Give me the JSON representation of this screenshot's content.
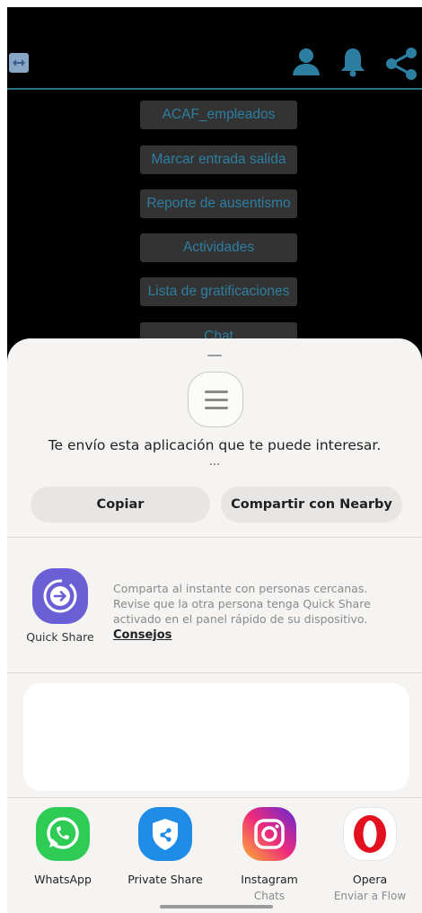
{
  "background_app": {
    "menu": [
      "ACAF_empleados",
      "Marcar entrada salida",
      "Reporte de ausentismo",
      "Actividades",
      "Lista de gratificaciones",
      "Chat"
    ],
    "header_icons": [
      "user-icon",
      "bell-icon",
      "share-icon"
    ],
    "accent_color": "#2d7fa2"
  },
  "share_sheet": {
    "message": "Te envío esta aplicación que te puede interesar.",
    "ellipsis": "...",
    "copy_label": "Copiar",
    "nearby_label": "Compartir con Nearby",
    "quick_share": {
      "label": "Quick Share",
      "description": "Comparta al instante con personas cercanas. Revise que la otra persona tenga Quick Share activado en el panel rápido de su dispositivo.",
      "link": "Consejos"
    },
    "apps": [
      {
        "name": "WhatsApp",
        "sub": "",
        "icon": "whatsapp-icon"
      },
      {
        "name": "Private Share",
        "sub": "",
        "icon": "private-share-icon"
      },
      {
        "name": "Instagram",
        "sub": "Chats",
        "icon": "instagram-icon"
      },
      {
        "name": "Opera",
        "sub": "Enviar a Flow",
        "icon": "opera-icon"
      }
    ]
  }
}
